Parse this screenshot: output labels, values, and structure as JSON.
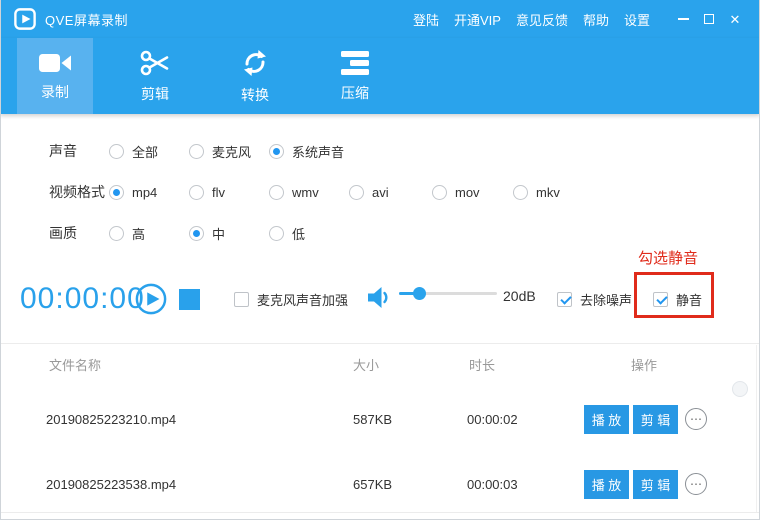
{
  "titlebar": {
    "title": "QVE屏幕录制",
    "links": {
      "login": "登陆",
      "vip": "开通VIP",
      "feedback": "意见反馈",
      "help": "帮助",
      "settings": "设置"
    },
    "close_glyph": "✕"
  },
  "tabs": {
    "record": "录制",
    "edit": "剪辑",
    "convert": "转换",
    "compress": "压缩",
    "active": "录制"
  },
  "options": {
    "sound": {
      "label": "声音",
      "all": "全部",
      "mic": "麦克风",
      "system": "系统声音",
      "selected": "系统声音"
    },
    "format": {
      "label": "视频格式",
      "mp4": "mp4",
      "flv": "flv",
      "wmv": "wmv",
      "avi": "avi",
      "mov": "mov",
      "mkv": "mkv",
      "selected": "mp4"
    },
    "quality": {
      "label": "画质",
      "high": "高",
      "mid": "中",
      "low": "低",
      "selected": "中"
    }
  },
  "controls": {
    "timer": "00:00:00",
    "mic_boost_label": "麦克风声音加强",
    "mic_boost_checked": false,
    "db_value": "20dB",
    "volume_percent": 20,
    "denoise_label": "去除噪声",
    "denoise_checked": true,
    "mute_label": "静音",
    "mute_checked": true,
    "annotation": "勾选静音"
  },
  "table": {
    "col_name": "文件名称",
    "col_size": "大小",
    "col_duration": "时长",
    "col_action": "操作",
    "more_glyph": "⋯",
    "rows": [
      {
        "name": "20190825223210.mp4",
        "size": "587KB",
        "duration": "00:00:02",
        "play": "播 放",
        "edit": "剪 辑"
      },
      {
        "name": "20190825223538.mp4",
        "size": "657KB",
        "duration": "00:00:03",
        "play": "播 放",
        "edit": "剪 辑"
      }
    ]
  },
  "colors": {
    "header_blue": "#2AA3EC",
    "active_tab_blue": "#58B2EF",
    "accent_blue": "#2196F0",
    "button_blue": "#2898E4",
    "annotation_red": "#E02B1B"
  }
}
